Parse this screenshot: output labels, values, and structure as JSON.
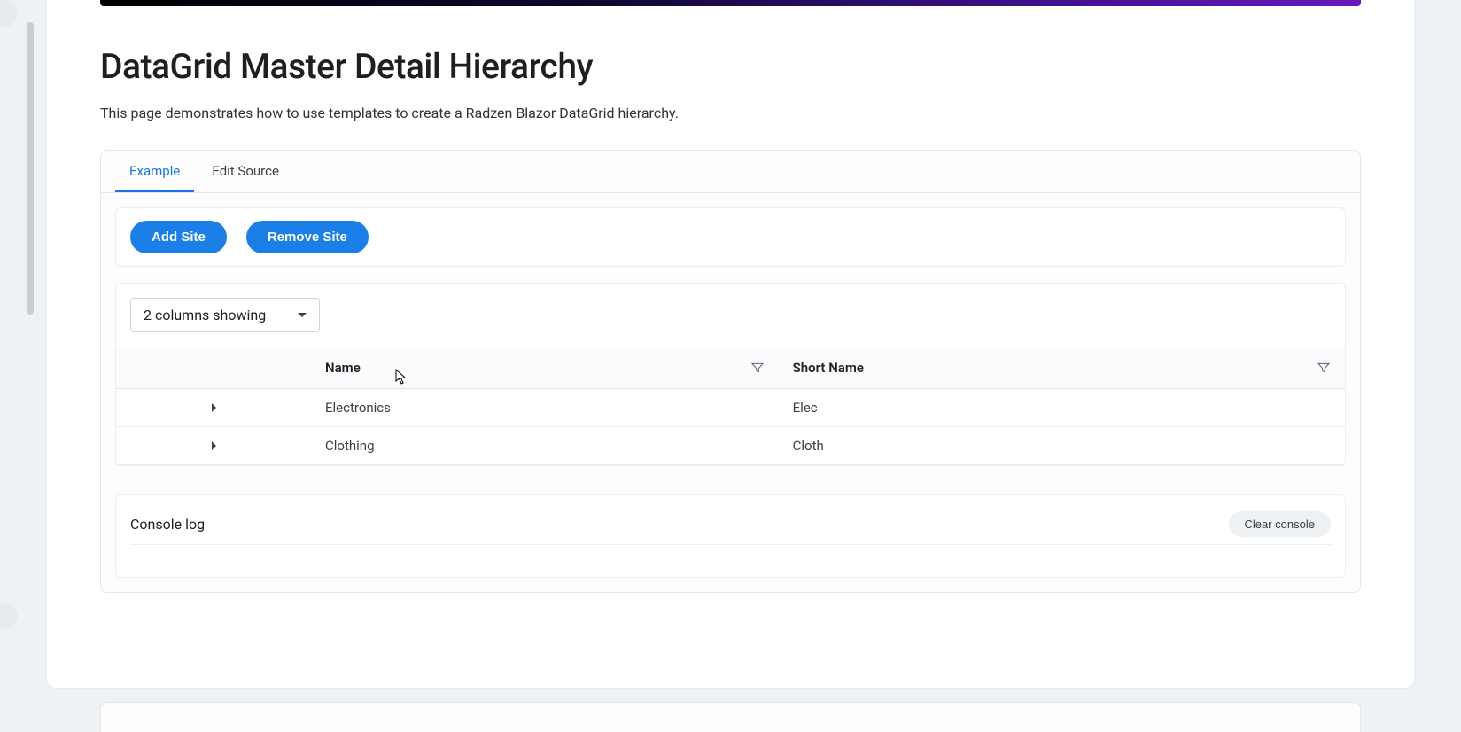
{
  "page": {
    "title": "DataGrid Master Detail Hierarchy",
    "description": "This page demonstrates how to use templates to create a Radzen Blazor DataGrid hierarchy."
  },
  "tabs": {
    "example": "Example",
    "edit_source": "Edit Source"
  },
  "toolbar": {
    "add_site": "Add Site",
    "remove_site": "Remove Site"
  },
  "dropdown": {
    "label": "2 columns showing"
  },
  "grid": {
    "columns": {
      "name": "Name",
      "short_name": "Short Name"
    },
    "rows": [
      {
        "name": "Electronics",
        "short_name": "Elec"
      },
      {
        "name": "Clothing",
        "short_name": "Cloth"
      }
    ]
  },
  "console": {
    "title": "Console log",
    "clear": "Clear console"
  }
}
